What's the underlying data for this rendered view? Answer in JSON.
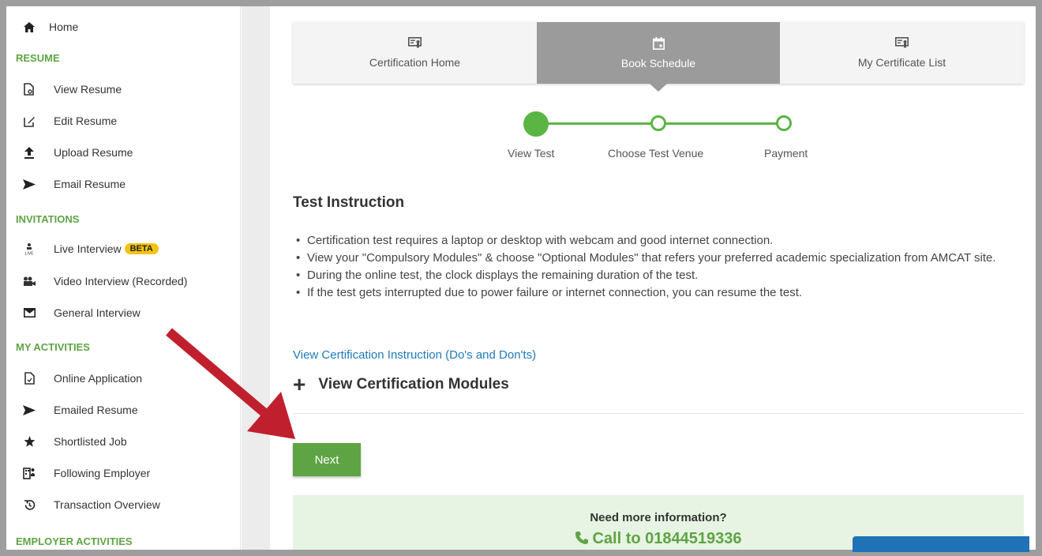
{
  "sidebar": {
    "home": "Home",
    "resume_header": "RESUME",
    "resume_items": [
      "View Resume",
      "Edit Resume",
      "Upload Resume",
      "Email Resume"
    ],
    "invitations_header": "INVITATIONS",
    "live_interview": "Live Interview",
    "beta_badge": "BETA",
    "video_interview": "Video Interview (Recorded)",
    "general_interview": "General Interview",
    "activities_header": "MY ACTIVITIES",
    "activity_items": [
      "Online Application",
      "Emailed Resume",
      "Shortlisted Job",
      "Following Employer",
      "Transaction Overview"
    ],
    "employer_header": "EMPLOYER ACTIVITIES"
  },
  "tabs": [
    "Certification Home",
    "Book Schedule",
    "My Certificate List"
  ],
  "steps": [
    "View Test",
    "Choose Test Venue",
    "Payment"
  ],
  "instruction": {
    "title": "Test Instruction",
    "bullets": [
      "Certification test requires a laptop or desktop with webcam and good internet connection.",
      "View your \"Compulsory Modules\" & choose \"Optional Modules\" that refers your preferred academic specialization from AMCAT site.",
      "During the online test, the clock displays the remaining duration of the test.",
      "If the test gets interrupted due to power failure or internet connection, you can resume the test."
    ],
    "link": "View Certification Instruction (Do's and Don'ts)",
    "modules": "View Certification Modules"
  },
  "next_label": "Next",
  "help": {
    "question": "Need more information?",
    "call": "Call to 01844519336"
  },
  "colors": {
    "green": "#5ea444",
    "link": "#1e7ab8",
    "arrow": "#c0202e"
  }
}
